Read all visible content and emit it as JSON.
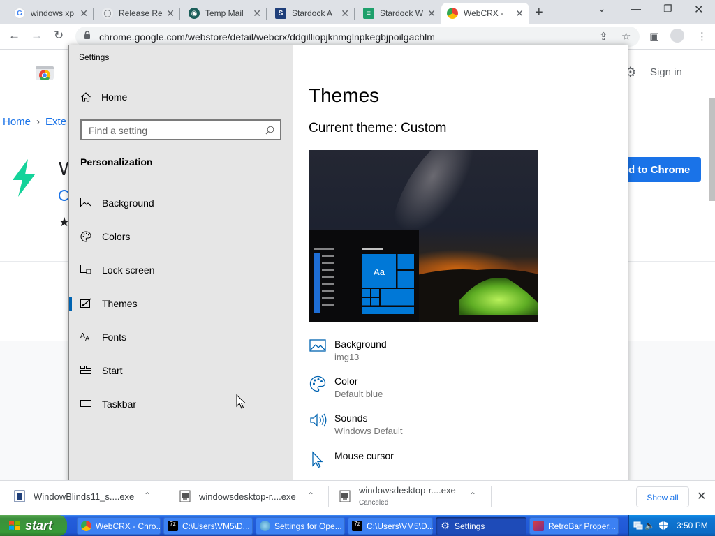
{
  "browser": {
    "tabs": [
      {
        "title": "windows xp",
        "favicon": "google-icon",
        "color": "#ffffff"
      },
      {
        "title": "Release Re",
        "favicon": "github-icon",
        "color": "#ffffff"
      },
      {
        "title": "Temp Mail",
        "favicon": "tempmail-icon",
        "color": "#ffffff"
      },
      {
        "title": "Stardock A",
        "favicon": "stardock-icon",
        "color": "#ffffff"
      },
      {
        "title": "Stardock W",
        "favicon": "stardock-wb-icon",
        "color": "#ffffff"
      },
      {
        "title": "WebCRX -",
        "favicon": "webcrx-icon",
        "color": "#ffffff"
      }
    ],
    "url": "chrome.google.com/webstore/detail/webcrx/ddgilliopjknmglnpkegbjpoilgachlm"
  },
  "webstore": {
    "sign_in": "Sign in",
    "breadcrumb_home": "Home",
    "breadcrumb_ext": "Exte",
    "ext_initial": "W",
    "add_button": "d to Chrome"
  },
  "settings": {
    "app_title": "Settings",
    "home": "Home",
    "search_placeholder": "Find a setting",
    "section": "Personalization",
    "nav": [
      {
        "label": "Background",
        "icon": "picture-icon"
      },
      {
        "label": "Colors",
        "icon": "palette-icon"
      },
      {
        "label": "Lock screen",
        "icon": "lock-screen-icon"
      },
      {
        "label": "Themes",
        "icon": "themes-icon"
      },
      {
        "label": "Fonts",
        "icon": "fonts-icon"
      },
      {
        "label": "Start",
        "icon": "start-icon"
      },
      {
        "label": "Taskbar",
        "icon": "taskbar-icon"
      }
    ],
    "selected_nav": "Themes",
    "page_title": "Themes",
    "current_theme": "Current theme: Custom",
    "preview_tile_label": "Aa",
    "properties": [
      {
        "title": "Background",
        "value": "img13",
        "icon": "picture-icon"
      },
      {
        "title": "Color",
        "value": "Default blue",
        "icon": "palette-icon"
      },
      {
        "title": "Sounds",
        "value": "Windows Default",
        "icon": "speaker-icon"
      },
      {
        "title": "Mouse cursor",
        "value": "",
        "icon": "cursor-icon"
      }
    ]
  },
  "downloads": {
    "items": [
      {
        "name": "WindowBlinds11_s....exe",
        "status": ""
      },
      {
        "name": "windowsdesktop-r....exe",
        "status": ""
      },
      {
        "name": "windowsdesktop-r....exe",
        "status": "Canceled"
      }
    ],
    "show_all": "Show all"
  },
  "taskbar": {
    "start_label": "start",
    "buttons": [
      {
        "label": "WebCRX - Chro...",
        "icon": "chrome-icon"
      },
      {
        "label": "C:\\Users\\VM5\\D...",
        "icon": "7zip-icon"
      },
      {
        "label": "Settings for Ope...",
        "icon": "globe-icon"
      },
      {
        "label": "C:\\Users\\VM5\\D...",
        "icon": "7zip-icon"
      },
      {
        "label": "Settings",
        "icon": "gear-icon"
      },
      {
        "label": "RetroBar Proper...",
        "icon": "retrobar-icon"
      }
    ],
    "clock": "3:50 PM"
  },
  "colors": {
    "accent": "#0063b1",
    "chrome_blue": "#1a73e8",
    "xp_taskbar": "#245edb",
    "xp_start": "#3c8f3c"
  }
}
